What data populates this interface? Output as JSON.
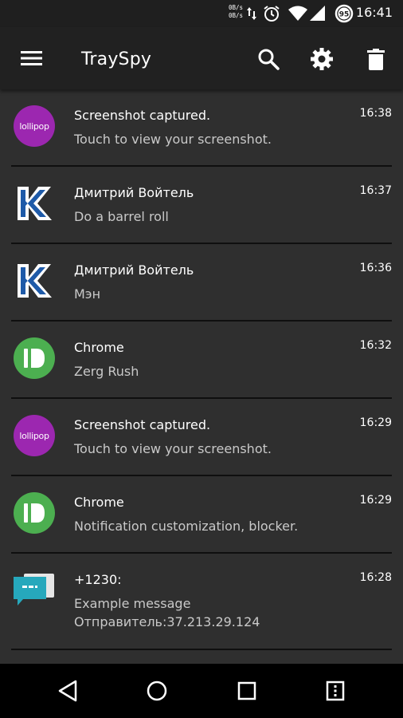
{
  "status_bar": {
    "net_up": "0B/s",
    "net_down": "0B/s",
    "battery": "95",
    "time": "16:41"
  },
  "app_bar": {
    "title": "TraySpy",
    "menu_icon": "menu-icon",
    "search_icon": "search-icon",
    "settings_icon": "gear-icon",
    "delete_icon": "trash-icon"
  },
  "notifications": [
    {
      "icon": "lollipop-icon",
      "icon_text": "lollipop",
      "app": "Screenshot captured.",
      "message": "Touch to view your screenshot.",
      "time": "16:38"
    },
    {
      "icon": "vk-icon",
      "app": "Дмитрий Войтель",
      "message": "Do a barrel roll",
      "time": "16:37"
    },
    {
      "icon": "vk-icon",
      "app": "Дмитрий Войтель",
      "message": "Мэн",
      "time": "16:36"
    },
    {
      "icon": "pushbullet-icon",
      "app": "Chrome",
      "message": "Zerg Rush",
      "time": "16:32"
    },
    {
      "icon": "lollipop-icon",
      "icon_text": "lollipop",
      "app": "Screenshot captured.",
      "message": "Touch to view your screenshot.",
      "time": "16:29"
    },
    {
      "icon": "pushbullet-icon",
      "app": "Chrome",
      "message": "Notification customization, blocker.",
      "time": "16:29"
    },
    {
      "icon": "sms-icon",
      "app": "+1230:",
      "message": "Example message\nОтправитель:37.213.29.124",
      "time": "16:28"
    }
  ],
  "nav_bar": {
    "back": "back-icon",
    "home": "home-icon",
    "recents": "recents-icon",
    "menu": "overflow-icon"
  },
  "colors": {
    "background": "#2f2f2f",
    "app_bar": "#212121",
    "lollipop": "#9c27b0",
    "pushbullet": "#4caf50",
    "vk": "#2a5f9e",
    "sms": "#29b6c6"
  }
}
